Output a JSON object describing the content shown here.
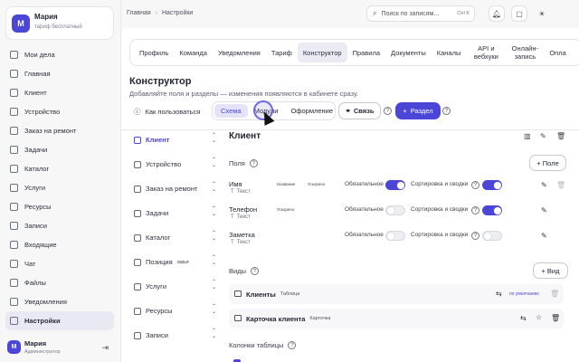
{
  "sidebar": {
    "profile": {
      "initial": "М",
      "name": "Мария",
      "plan": "тариф бесплатный"
    },
    "items": [
      {
        "label": "Мои дела",
        "icon": "tasks-icon"
      },
      {
        "label": "Главная",
        "icon": "home-icon"
      },
      {
        "label": "Клиент",
        "icon": "grid-icon"
      },
      {
        "label": "Устройство",
        "icon": "grid-icon"
      },
      {
        "label": "Заказ на ремонт",
        "icon": "grid-icon"
      },
      {
        "label": "Задачи",
        "icon": "grid-icon"
      },
      {
        "label": "Каталог",
        "icon": "tag-icon"
      },
      {
        "label": "Услуги",
        "icon": "service-icon"
      },
      {
        "label": "Ресурсы",
        "icon": "wrench-icon"
      },
      {
        "label": "Записи",
        "icon": "calendar-icon"
      },
      {
        "label": "Входящие",
        "icon": "inbox-icon"
      },
      {
        "label": "Чат",
        "icon": "chat-icon"
      },
      {
        "label": "Файлы",
        "icon": "file-icon"
      },
      {
        "label": "Уведомления",
        "icon": "bell-icon"
      },
      {
        "label": "Настройки",
        "icon": "settings-icon"
      }
    ],
    "active_index": 14,
    "user": {
      "initial": "М",
      "name": "Мария",
      "role": "Администратор"
    }
  },
  "topbar": {
    "breadcrumb": [
      "Главная",
      "Настройки"
    ],
    "search_placeholder": "Поиск по записям...",
    "search_shortcut": "Ctrl K"
  },
  "settings_tabs": [
    "Профиль",
    "Команда",
    "Уведомления",
    "Тариф",
    "Конструктор",
    "Правила",
    "Документы",
    "Каналы",
    "API и вебхуки",
    "Онлайн-запись",
    "Опла"
  ],
  "active_tab": "Конструктор",
  "page": {
    "title": "Конструктор",
    "subtitle": "Добавляйте поля и разделы — изменения появляются в кабинете сразу.",
    "how_to": "Как пользоваться",
    "modes": [
      "Схема",
      "Модули",
      "Оформление"
    ],
    "active_mode": "Схема",
    "link_button": "Связь",
    "section_button": "Раздел"
  },
  "entities": [
    {
      "label": "Клиент",
      "active": true,
      "badge": ""
    },
    {
      "label": "Устройство",
      "active": false,
      "badge": ""
    },
    {
      "label": "Заказ на ремонт",
      "active": false,
      "badge": ""
    },
    {
      "label": "Задачи",
      "active": false,
      "badge": ""
    },
    {
      "label": "Каталог",
      "active": false,
      "badge": ""
    },
    {
      "label": "Позиция",
      "active": false,
      "badge": "скрыт"
    },
    {
      "label": "Услуги",
      "active": false,
      "badge": ""
    },
    {
      "label": "Ресурсы",
      "active": false,
      "badge": ""
    },
    {
      "label": "Записи",
      "active": false,
      "badge": ""
    }
  ],
  "panel": {
    "title": "Клиент",
    "fields_label": "Поля",
    "add_field": "+ Поле",
    "fields": [
      {
        "name": "Имя",
        "type": "Текст",
        "tags": [
          "Название",
          "Ускорено"
        ],
        "required_label": "Обязательное",
        "required": true,
        "sort_label": "Сортировка и сводки",
        "sort": true
      },
      {
        "name": "Телефон",
        "type": "Текст",
        "tags": [
          "Ускорено"
        ],
        "required_label": "Обязательное",
        "required": false,
        "sort_label": "Сортировка и сводки",
        "sort": true
      },
      {
        "name": "Заметка",
        "type": "Текст",
        "tags": [],
        "required_label": "Обязательное",
        "required": false,
        "sort_label": "Сортировка и сводки",
        "sort": false
      }
    ],
    "views_label": "Виды",
    "add_view": "+ Вид",
    "views": [
      {
        "name": "Клиенты",
        "type": "Таблица",
        "default": "по умолчанию"
      },
      {
        "name": "Карточка клиента",
        "type": "Карточка",
        "default": ""
      }
    ],
    "columns_label": "Колонки таблицы"
  }
}
